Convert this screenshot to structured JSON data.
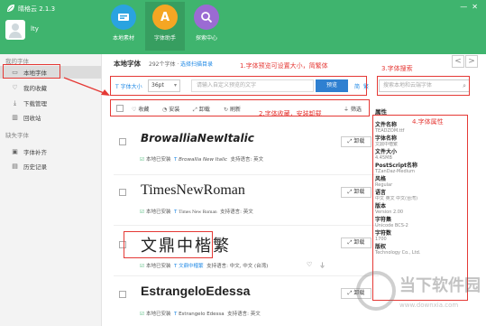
{
  "app": {
    "title": "晴格云 2.1.3",
    "user_name": "lty"
  },
  "nav_tabs": [
    {
      "label": "本地素材",
      "icon": "local-assets-icon",
      "color": "#2aa3e0"
    },
    {
      "label": "字体助手",
      "icon": "font-assistant-icon",
      "glyph": "A",
      "color": "#f5a623"
    },
    {
      "label": "探索中心",
      "icon": "explore-icon",
      "glyph": "Q",
      "color": "#9b6bd3"
    }
  ],
  "sidebar": {
    "section1": "我的字体",
    "items1": [
      {
        "label": "本地字体",
        "icon": "monitor-icon"
      },
      {
        "label": "我的收藏",
        "icon": "heart-icon"
      },
      {
        "label": "下载管理",
        "icon": "download-icon"
      },
      {
        "label": "回收站",
        "icon": "trash-icon"
      }
    ],
    "section2": "缺失字体",
    "items2": [
      {
        "label": "字体补齐",
        "icon": "font-fill-icon"
      },
      {
        "label": "历史记录",
        "icon": "history-icon"
      }
    ]
  },
  "main": {
    "title": "本地字体",
    "count_prefix": "292个字体 ·",
    "scan_link": "选择扫描目录",
    "prev": "<",
    "next": ">"
  },
  "toolbar": {
    "fontsize_label": "字体大小",
    "fontsize_value": "36pt",
    "preview_placeholder": "请输入自定义预览的文字",
    "preview_btn": "预览",
    "simplified": "简",
    "traditional": "繁",
    "search_placeholder": "搜索本地和云端字体"
  },
  "actions": {
    "favorite": "收藏",
    "install": "安装",
    "uninstall": "卸载",
    "refresh": "刷新",
    "filter": "筛选"
  },
  "annotations": {
    "a1": "1.字体预览可设置大小，简繁体",
    "a2": "2.字体收藏，安装卸载",
    "a3": "3.字体搜索",
    "a4": "4.字体属性"
  },
  "fonts": [
    {
      "name": "BrowalliaNewItalic",
      "installed": "本地已安装",
      "sample": "Browallia New Italic",
      "lang": "支持语言: 英文",
      "uninstall": "卸载"
    },
    {
      "name": "TimesNewRoman",
      "installed": "本地已安装",
      "sample": "Times New Roman",
      "lang": "支持语言: 英文",
      "uninstall": "卸载"
    },
    {
      "name": "文鼎中楷繁",
      "installed": "本地已安装",
      "sample": "文鼎中楷繁",
      "lang": "支持语言: 中文, 中文 (台湾)",
      "uninstall": "卸载"
    },
    {
      "name": "EstrangeloEdessa",
      "installed": "本地已安装",
      "sample": "Estrangelo Edessa",
      "lang": "支持语言: 英文",
      "uninstall": "卸载"
    }
  ],
  "properties": {
    "title": "属性",
    "items": [
      {
        "label": "文件名称",
        "value": "TEADZOM.ttf"
      },
      {
        "label": "字体名称",
        "value": "文鼎中楷繁"
      },
      {
        "label": "文件大小",
        "value": "4.45MB"
      },
      {
        "label": "PostScript名称",
        "value": "TZanDaz-Medium"
      },
      {
        "label": "风格",
        "value": "Regular"
      },
      {
        "label": "语言",
        "value": "中文 英文 中文(台湾)"
      },
      {
        "label": "版本",
        "value": "Version 2.00"
      },
      {
        "label": "字符集",
        "value": "Unicode BCS-2"
      },
      {
        "label": "字符数",
        "value": "1700"
      },
      {
        "label": "版权",
        "value": "Technology Co., Ltd."
      }
    ]
  },
  "watermark": {
    "text": "当下软件园",
    "url": "www.downxia.com"
  }
}
